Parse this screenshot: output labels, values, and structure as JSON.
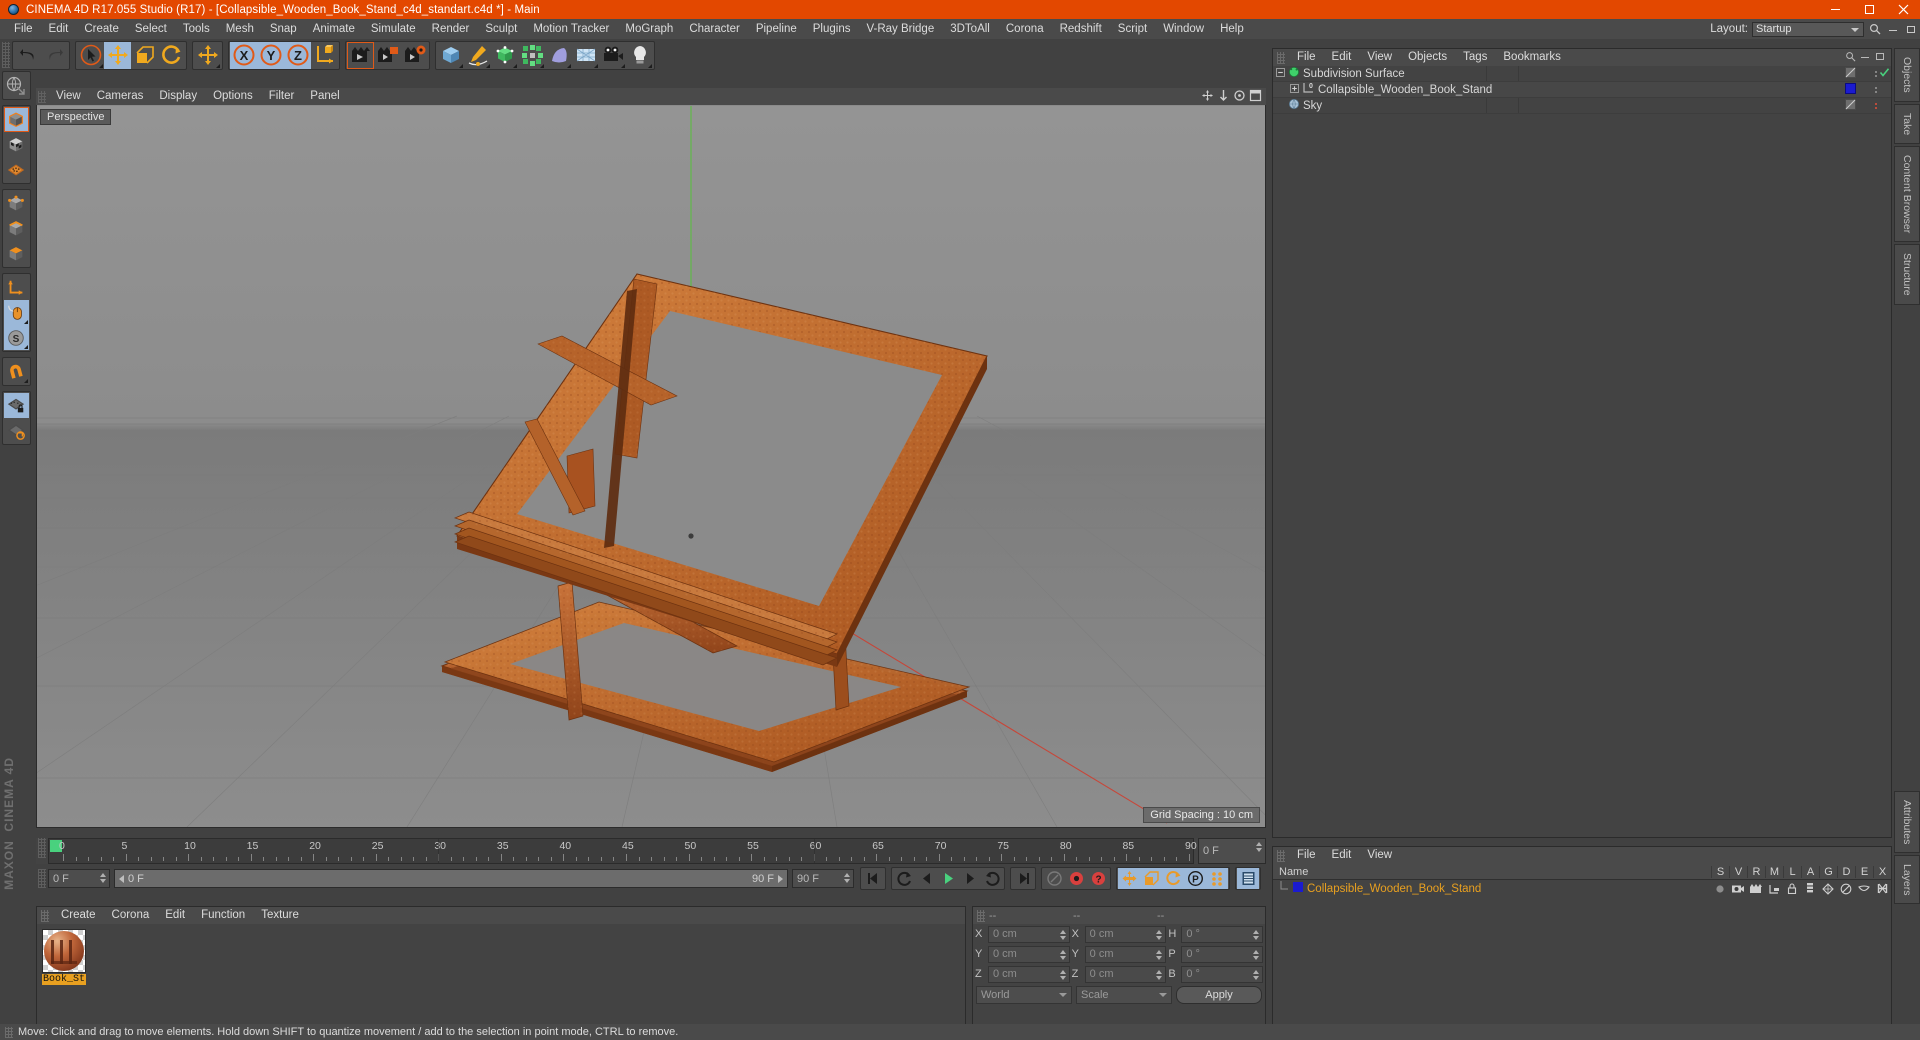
{
  "titlebar": {
    "title": "CINEMA 4D R17.055 Studio (R17) - [Collapsible_Wooden_Book_Stand_c4d_standart.c4d *] - Main",
    "minimize": "–",
    "maximize": "❑",
    "close": "✕",
    "accent": "#e34800"
  },
  "menubar": {
    "items": [
      {
        "label": "File"
      },
      {
        "label": "Edit"
      },
      {
        "label": "Create"
      },
      {
        "label": "Select"
      },
      {
        "label": "Tools"
      },
      {
        "label": "Mesh"
      },
      {
        "label": "Snap"
      },
      {
        "label": "Animate"
      },
      {
        "label": "Simulate"
      },
      {
        "label": "Render"
      },
      {
        "label": "Sculpt"
      },
      {
        "label": "Motion Tracker"
      },
      {
        "label": "MoGraph"
      },
      {
        "label": "Character"
      },
      {
        "label": "Pipeline"
      },
      {
        "label": "Plugins"
      },
      {
        "label": "V-Ray Bridge"
      },
      {
        "label": "3DToAll"
      },
      {
        "label": "Corona"
      },
      {
        "label": "Redshift"
      },
      {
        "label": "Script"
      },
      {
        "label": "Window"
      },
      {
        "label": "Help"
      }
    ],
    "layout_label": "Layout:",
    "layout_value": "Startup"
  },
  "viewport": {
    "menu": [
      {
        "label": "View"
      },
      {
        "label": "Cameras"
      },
      {
        "label": "Display"
      },
      {
        "label": "Options"
      },
      {
        "label": "Filter"
      },
      {
        "label": "Panel"
      }
    ],
    "view_label": "Perspective",
    "grid_spacing": "Grid Spacing : 10 cm",
    "axis_x_color": "#d23b2b",
    "axis_y_color": "#57c23a",
    "axis_z_color": "#3b6ed2",
    "model_color": "#c4692f"
  },
  "timeline": {
    "ticks": [
      "0",
      "5",
      "10",
      "15",
      "20",
      "25",
      "30",
      "35",
      "40",
      "45",
      "50",
      "55",
      "60",
      "65",
      "70",
      "75",
      "80",
      "85",
      "90"
    ],
    "current_frame_right": "0 F",
    "start_frame": "0 F",
    "scrub_left": "0 F",
    "scrub_right": "90 F",
    "end_frame": "90 F"
  },
  "material_manager": {
    "menu": [
      {
        "label": "Create"
      },
      {
        "label": "Corona"
      },
      {
        "label": "Edit"
      },
      {
        "label": "Function"
      },
      {
        "label": "Texture"
      }
    ],
    "materials": [
      {
        "name": "Book_St"
      }
    ]
  },
  "coordinates": {
    "headers": [
      "--",
      "--",
      "--"
    ],
    "rows": [
      {
        "l1": "X",
        "v1": "0 cm",
        "l2": "X",
        "v2": "0 cm",
        "l3": "H",
        "v3": "0 °"
      },
      {
        "l1": "Y",
        "v1": "0 cm",
        "l2": "Y",
        "v2": "0 cm",
        "l3": "P",
        "v3": "0 °"
      },
      {
        "l1": "Z",
        "v1": "0 cm",
        "l2": "Z",
        "v2": "0 cm",
        "l3": "B",
        "v3": "0 °"
      }
    ],
    "system": "World",
    "mode": "Scale",
    "apply": "Apply"
  },
  "object_manager": {
    "menu": [
      {
        "label": "File"
      },
      {
        "label": "Edit"
      },
      {
        "label": "View"
      },
      {
        "label": "Objects"
      },
      {
        "label": "Tags"
      },
      {
        "label": "Bookmarks"
      }
    ],
    "rows": [
      {
        "name": "Subdivision Surface",
        "indent": 0,
        "icon": "subdivision-surface-icon",
        "tag": "checkmark",
        "dot": "grey"
      },
      {
        "name": "Collapsible_Wooden_Book_Stand",
        "indent": 1,
        "icon": "null-object-icon",
        "tag": "material-blue",
        "dot": "grey"
      },
      {
        "name": "Sky",
        "indent": 0,
        "icon": "sky-icon",
        "tag": "none",
        "dot": "red"
      }
    ]
  },
  "attribute_manager": {
    "menu": [
      {
        "label": "File"
      },
      {
        "label": "Edit"
      },
      {
        "label": "View"
      }
    ],
    "columns": [
      "Name",
      "S",
      "V",
      "R",
      "M",
      "L",
      "A",
      "G",
      "D",
      "E",
      "X"
    ],
    "rows": [
      {
        "name": "Collapsible_Wooden_Book_Stand"
      }
    ]
  },
  "right_tabs": [
    {
      "label": "Objects"
    },
    {
      "label": "Take"
    },
    {
      "label": "Content Browser"
    },
    {
      "label": "Structure"
    },
    {
      "label": "Attributes"
    },
    {
      "label": "Layers"
    }
  ],
  "statusbar": {
    "text": "Move: Click and drag to move elements. Hold down SHIFT to quantize movement / add to the selection in point mode, CTRL to remove."
  },
  "branding": {
    "maxon": "MAXON",
    "c4d": "CINEMA 4D"
  }
}
